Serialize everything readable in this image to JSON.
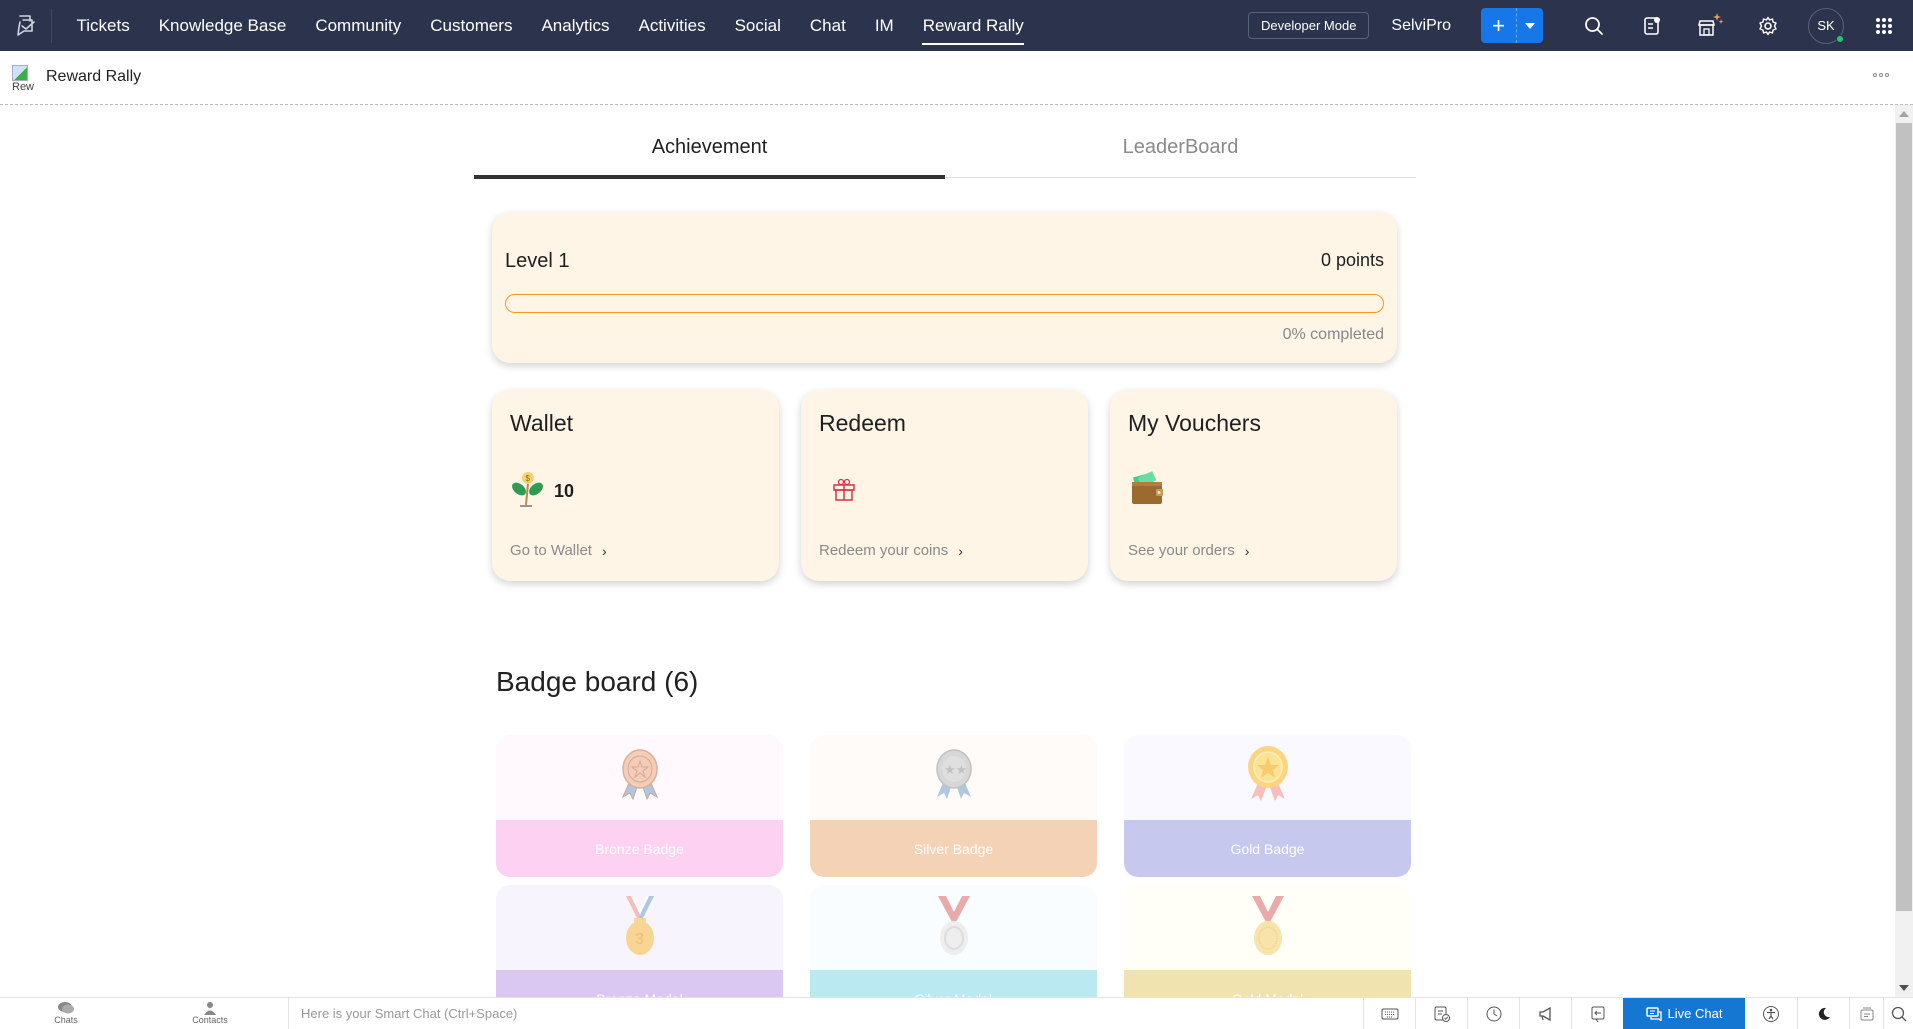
{
  "topbar": {
    "nav": [
      {
        "label": "Tickets",
        "active": false
      },
      {
        "label": "Knowledge Base",
        "active": false
      },
      {
        "label": "Community",
        "active": false
      },
      {
        "label": "Customers",
        "active": false
      },
      {
        "label": "Analytics",
        "active": false
      },
      {
        "label": "Activities",
        "active": false
      },
      {
        "label": "Social",
        "active": false
      },
      {
        "label": "Chat",
        "active": false
      },
      {
        "label": "IM",
        "active": false
      },
      {
        "label": "Reward Rally",
        "active": true
      }
    ],
    "developer_mode": "Developer Mode",
    "org_name": "SelviPro",
    "avatar_initials": "SK",
    "icons": [
      "add-icon",
      "caret-down-icon",
      "search-icon",
      "notes-icon",
      "marketplace-icon",
      "gear-icon",
      "apps-grid-icon"
    ]
  },
  "subheader": {
    "image_alt": "Rew",
    "title": "Reward Rally"
  },
  "tabs": [
    {
      "label": "Achievement",
      "active": true
    },
    {
      "label": "LeaderBoard",
      "active": false
    }
  ],
  "level": {
    "level_label": "Level 1",
    "points": "0 points",
    "progress_fraction": 0,
    "completed_text": "0% completed",
    "accent": "#f29a1c"
  },
  "cards": [
    {
      "title": "Wallet",
      "icon": "money-plant-icon",
      "value": "10",
      "link": "Go to Wallet"
    },
    {
      "title": "Redeem",
      "icon": "gift-icon",
      "value": "",
      "link": "Redeem your coins"
    },
    {
      "title": "My Vouchers",
      "icon": "wallet-icon",
      "value": "",
      "link": "See your orders"
    }
  ],
  "badge_board": {
    "title": "Badge board (6)",
    "badges": [
      {
        "name": "Bronze Badge",
        "icon": "bronze-badge-icon",
        "top_color": "#fff6fb",
        "bottom_color": "#fbc0ec"
      },
      {
        "name": "Silver Badge",
        "icon": "silver-badge-icon",
        "top_color": "#fffaf7",
        "bottom_color": "#efc29b"
      },
      {
        "name": "Gold Badge",
        "icon": "gold-badge-icon",
        "top_color": "#f8f7ff",
        "bottom_color": "#b1b3e8"
      },
      {
        "name": "Bronze Medal",
        "icon": "bronze-medal-icon",
        "top_color": "#f6f1fd",
        "bottom_color": "#cdb3ef"
      },
      {
        "name": "Silver Medal",
        "icon": "silver-medal-icon",
        "top_color": "#f7fdff",
        "bottom_color": "#a2e1ee"
      },
      {
        "name": "Gold Medal",
        "icon": "gold-medal-icon",
        "top_color": "#fffef4",
        "bottom_color": "#ecd992"
      }
    ]
  },
  "bottombar": {
    "chats": "Chats",
    "contacts": "Contacts",
    "smart_chat_placeholder": "Here is your Smart Chat (Ctrl+Space)",
    "live_chat": "Live Chat"
  }
}
